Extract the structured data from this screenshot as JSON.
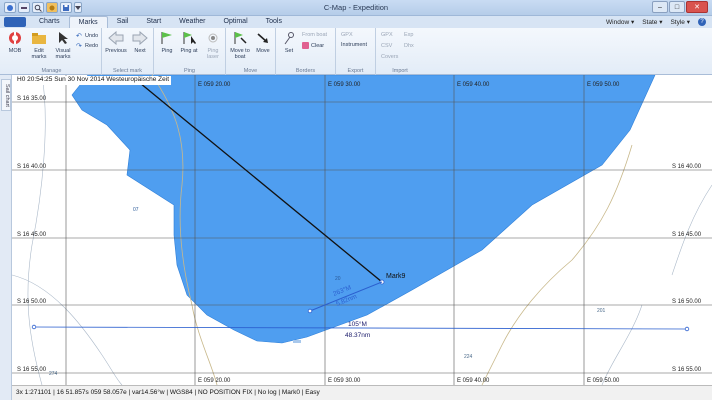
{
  "window": {
    "title": "C-Map - Expedition",
    "controls": [
      "minimize-icon",
      "maximize-icon",
      "close-icon"
    ]
  },
  "tabs": [
    "Charts",
    "Marks",
    "Sail",
    "Start",
    "Weather",
    "Optimal",
    "Tools"
  ],
  "active_tab": "Marks",
  "right_menus": [
    "Window ▾",
    "State ▾",
    "Style ▾"
  ],
  "ribbon": {
    "manage": {
      "label": "Manage",
      "mob": "MOB",
      "edit_marks": "Edit marks",
      "visual_marks": "Visual marks",
      "undo": "Undo",
      "redo": "Redo"
    },
    "select_mark": {
      "label": "Select mark",
      "previous": "Previous",
      "next": "Next"
    },
    "ping": {
      "label": "Ping",
      "ping": "Ping",
      "ping_at": "Ping at",
      "ping_laser": "Ping laser"
    },
    "move": {
      "label": "Move",
      "move_to_boat": "Move to boat",
      "move": "Move"
    },
    "borders": {
      "label": "Borders",
      "set": "Set",
      "from_boat": "From boat",
      "clear": "Clear"
    },
    "export": {
      "label": "Export",
      "gpx": "GPX",
      "instrument": "Instrument"
    },
    "import": {
      "label": "Import",
      "gpx": "GPX",
      "exp": "Exp",
      "csv": "CSV",
      "dhx": "Dhx",
      "covers": "Covers"
    }
  },
  "sidebar": {
    "tab": "Sail chart"
  },
  "map": {
    "time_bar": "H0 20:54:25 Sun 30 Nov 2014 Westeuropäische Zeit",
    "lon_labels": [
      "E 059 20.00",
      "E 059 30.00",
      "E 059 40.00",
      "E 059 50.00"
    ],
    "lon_labels_bottom": [
      "E 059 20.00",
      "E 059 30.00",
      "E 059 40.00",
      "E 059 50.00"
    ],
    "lat_labels_left": [
      "S 16 35.00",
      "S 16 40.00",
      "S 16 45.00",
      "S 16 50.00",
      "S 16 55.00"
    ],
    "lat_labels_right": [
      "S 16 40.00",
      "S 16 45.00",
      "S 16 50.00",
      "S 16 55.00"
    ],
    "mark_label": "Mark9",
    "leg1_bearing": "263°M",
    "leg1_distance": "5.82nm",
    "leg2_bearing": "105°M",
    "leg2_distance": "48.37nm",
    "depth_labels": [
      "20",
      "201",
      "224",
      "274",
      "07"
    ],
    "colors": {
      "shallow_area": "#4f9ef0",
      "route_line": "#2b5fcf",
      "grid": "#555555",
      "contour": "#c8b88a"
    }
  },
  "status_bar": "3x 1:271101 | 16 51.857s 059 58.057e | var14.56°w | WGS84 | NO POSITION FIX | No log | Mark0 | Easy"
}
